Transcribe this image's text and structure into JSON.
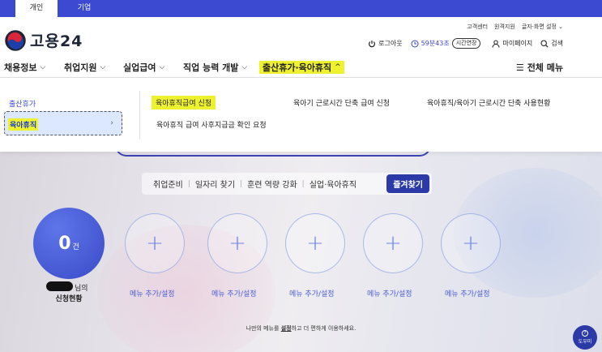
{
  "top_tabs": [
    {
      "label": "개인",
      "active": true
    },
    {
      "label": "기업",
      "active": false
    }
  ],
  "util_links": [
    "고객센터",
    "원격지원",
    "글자·화면 설정 ⌄"
  ],
  "logo": {
    "text": "고용24"
  },
  "session": {
    "logout_label": "로그아웃",
    "timer": "59분43초",
    "extend_label": "시간연장",
    "mypage_label": "마이페이지",
    "search_label": "검색"
  },
  "gnb": {
    "items": [
      {
        "label": "채용정보",
        "highlight": false
      },
      {
        "label": "취업지원",
        "highlight": false
      },
      {
        "label": "실업급여",
        "highlight": false
      },
      {
        "label": "직업 능력 개발",
        "highlight": false
      },
      {
        "label": "출산휴가·육아휴직",
        "highlight": true
      }
    ],
    "all_menu_label": "전체 메뉴"
  },
  "mega_menu": {
    "categories": [
      {
        "label": "출산휴가",
        "selected": false
      },
      {
        "label": "육아휴직",
        "selected": true
      }
    ],
    "submenu": [
      {
        "label": "육아휴직급여 신청",
        "highlight": true
      },
      {
        "label": "육아기 근로시간 단축 급여 신청",
        "highlight": false
      },
      {
        "label": "육아휴직/육아기 근로시간 단축 사용현황",
        "highlight": false
      },
      {
        "label": "육아휴직 급여 사후지급금 확인 요청",
        "highlight": false
      }
    ]
  },
  "hero": {
    "tabs": [
      "취업준비",
      "일자리 찾기",
      "훈련 역량 강화",
      "실업·육아휴직"
    ],
    "active_tab": "즐겨찾기",
    "count_value": "0",
    "count_unit": "건",
    "user_suffix": "님의",
    "status_title": "신청현황",
    "slot_label": "메뉴 추가/설정",
    "footnote_pre": "나만의 메뉴를 ",
    "footnote_link": "설정",
    "footnote_post": "하고 더 편하게 이용하세요.",
    "helper_label": "도우미"
  },
  "colors": {
    "brand": "#3b4ad1",
    "highlight": "#eef12e",
    "dark_blue": "#2b3aa6"
  }
}
